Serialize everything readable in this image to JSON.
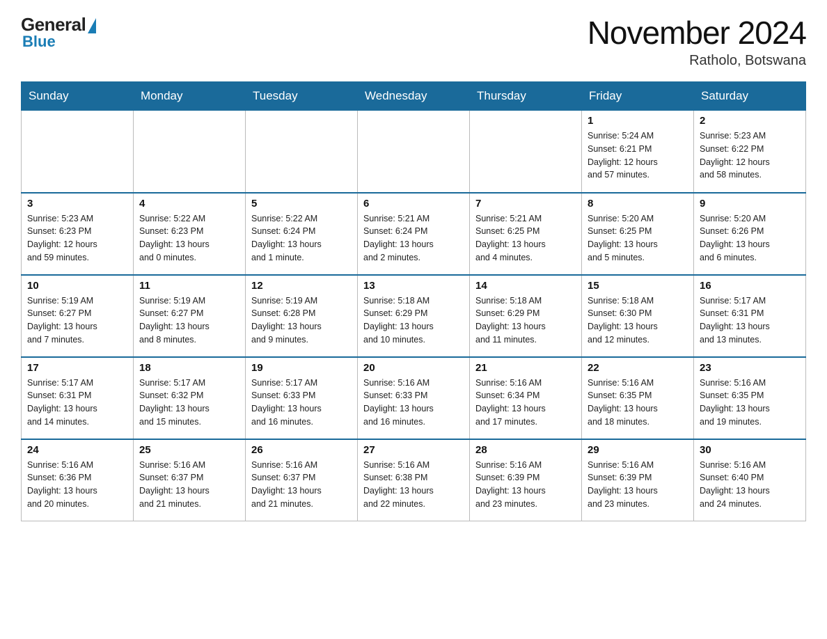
{
  "header": {
    "logo": {
      "general": "General",
      "blue": "Blue"
    },
    "month_year": "November 2024",
    "location": "Ratholo, Botswana"
  },
  "days_of_week": [
    "Sunday",
    "Monday",
    "Tuesday",
    "Wednesday",
    "Thursday",
    "Friday",
    "Saturday"
  ],
  "weeks": [
    [
      {
        "day": "",
        "info": ""
      },
      {
        "day": "",
        "info": ""
      },
      {
        "day": "",
        "info": ""
      },
      {
        "day": "",
        "info": ""
      },
      {
        "day": "",
        "info": ""
      },
      {
        "day": "1",
        "info": "Sunrise: 5:24 AM\nSunset: 6:21 PM\nDaylight: 12 hours\nand 57 minutes."
      },
      {
        "day": "2",
        "info": "Sunrise: 5:23 AM\nSunset: 6:22 PM\nDaylight: 12 hours\nand 58 minutes."
      }
    ],
    [
      {
        "day": "3",
        "info": "Sunrise: 5:23 AM\nSunset: 6:23 PM\nDaylight: 12 hours\nand 59 minutes."
      },
      {
        "day": "4",
        "info": "Sunrise: 5:22 AM\nSunset: 6:23 PM\nDaylight: 13 hours\nand 0 minutes."
      },
      {
        "day": "5",
        "info": "Sunrise: 5:22 AM\nSunset: 6:24 PM\nDaylight: 13 hours\nand 1 minute."
      },
      {
        "day": "6",
        "info": "Sunrise: 5:21 AM\nSunset: 6:24 PM\nDaylight: 13 hours\nand 2 minutes."
      },
      {
        "day": "7",
        "info": "Sunrise: 5:21 AM\nSunset: 6:25 PM\nDaylight: 13 hours\nand 4 minutes."
      },
      {
        "day": "8",
        "info": "Sunrise: 5:20 AM\nSunset: 6:25 PM\nDaylight: 13 hours\nand 5 minutes."
      },
      {
        "day": "9",
        "info": "Sunrise: 5:20 AM\nSunset: 6:26 PM\nDaylight: 13 hours\nand 6 minutes."
      }
    ],
    [
      {
        "day": "10",
        "info": "Sunrise: 5:19 AM\nSunset: 6:27 PM\nDaylight: 13 hours\nand 7 minutes."
      },
      {
        "day": "11",
        "info": "Sunrise: 5:19 AM\nSunset: 6:27 PM\nDaylight: 13 hours\nand 8 minutes."
      },
      {
        "day": "12",
        "info": "Sunrise: 5:19 AM\nSunset: 6:28 PM\nDaylight: 13 hours\nand 9 minutes."
      },
      {
        "day": "13",
        "info": "Sunrise: 5:18 AM\nSunset: 6:29 PM\nDaylight: 13 hours\nand 10 minutes."
      },
      {
        "day": "14",
        "info": "Sunrise: 5:18 AM\nSunset: 6:29 PM\nDaylight: 13 hours\nand 11 minutes."
      },
      {
        "day": "15",
        "info": "Sunrise: 5:18 AM\nSunset: 6:30 PM\nDaylight: 13 hours\nand 12 minutes."
      },
      {
        "day": "16",
        "info": "Sunrise: 5:17 AM\nSunset: 6:31 PM\nDaylight: 13 hours\nand 13 minutes."
      }
    ],
    [
      {
        "day": "17",
        "info": "Sunrise: 5:17 AM\nSunset: 6:31 PM\nDaylight: 13 hours\nand 14 minutes."
      },
      {
        "day": "18",
        "info": "Sunrise: 5:17 AM\nSunset: 6:32 PM\nDaylight: 13 hours\nand 15 minutes."
      },
      {
        "day": "19",
        "info": "Sunrise: 5:17 AM\nSunset: 6:33 PM\nDaylight: 13 hours\nand 16 minutes."
      },
      {
        "day": "20",
        "info": "Sunrise: 5:16 AM\nSunset: 6:33 PM\nDaylight: 13 hours\nand 16 minutes."
      },
      {
        "day": "21",
        "info": "Sunrise: 5:16 AM\nSunset: 6:34 PM\nDaylight: 13 hours\nand 17 minutes."
      },
      {
        "day": "22",
        "info": "Sunrise: 5:16 AM\nSunset: 6:35 PM\nDaylight: 13 hours\nand 18 minutes."
      },
      {
        "day": "23",
        "info": "Sunrise: 5:16 AM\nSunset: 6:35 PM\nDaylight: 13 hours\nand 19 minutes."
      }
    ],
    [
      {
        "day": "24",
        "info": "Sunrise: 5:16 AM\nSunset: 6:36 PM\nDaylight: 13 hours\nand 20 minutes."
      },
      {
        "day": "25",
        "info": "Sunrise: 5:16 AM\nSunset: 6:37 PM\nDaylight: 13 hours\nand 21 minutes."
      },
      {
        "day": "26",
        "info": "Sunrise: 5:16 AM\nSunset: 6:37 PM\nDaylight: 13 hours\nand 21 minutes."
      },
      {
        "day": "27",
        "info": "Sunrise: 5:16 AM\nSunset: 6:38 PM\nDaylight: 13 hours\nand 22 minutes."
      },
      {
        "day": "28",
        "info": "Sunrise: 5:16 AM\nSunset: 6:39 PM\nDaylight: 13 hours\nand 23 minutes."
      },
      {
        "day": "29",
        "info": "Sunrise: 5:16 AM\nSunset: 6:39 PM\nDaylight: 13 hours\nand 23 minutes."
      },
      {
        "day": "30",
        "info": "Sunrise: 5:16 AM\nSunset: 6:40 PM\nDaylight: 13 hours\nand 24 minutes."
      }
    ]
  ]
}
